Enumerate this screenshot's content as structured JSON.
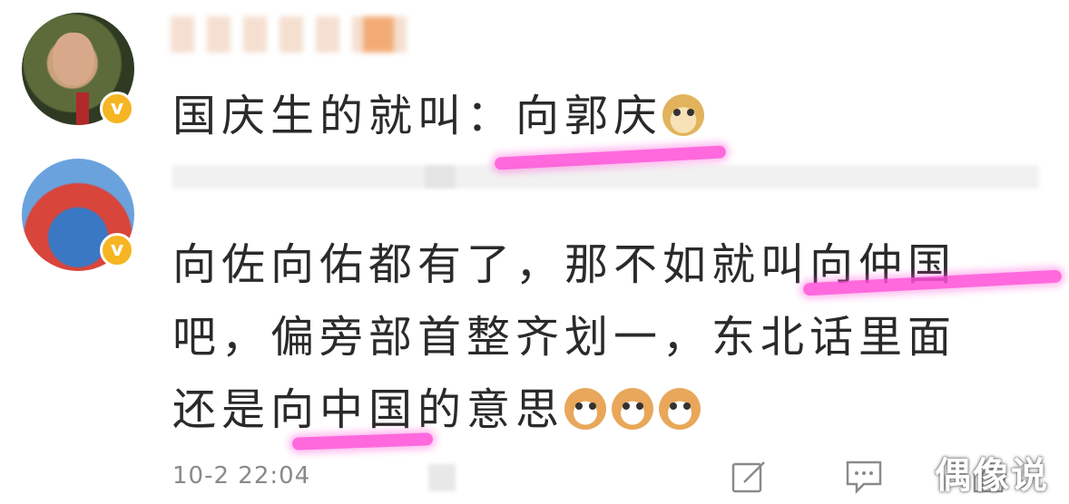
{
  "comments": [
    {
      "text": "国庆生的就叫：向郭庆",
      "verified_badge": "v",
      "emoji": [
        "doge-emoji"
      ]
    },
    {
      "line1": "向佐向佑都有了，那不如就叫向仲国",
      "line2": "吧，偏旁部首整齐划一，东北话里面",
      "line3": "还是向中国的意思",
      "verified_badge": "v",
      "emoji": [
        "cat-emoji",
        "cat-emoji",
        "cat-emoji"
      ],
      "timestamp": "10-2 22:04"
    }
  ],
  "actions": {
    "edit_icon": "edit-icon",
    "reply_icon": "comment-icon",
    "like_icon": "like-icon"
  },
  "watermark": "偶像说",
  "colors": {
    "highlight": "#ff4fd8",
    "badge": "#f6b522",
    "text": "#2a2a2a",
    "meta": "#8a8a8a"
  }
}
